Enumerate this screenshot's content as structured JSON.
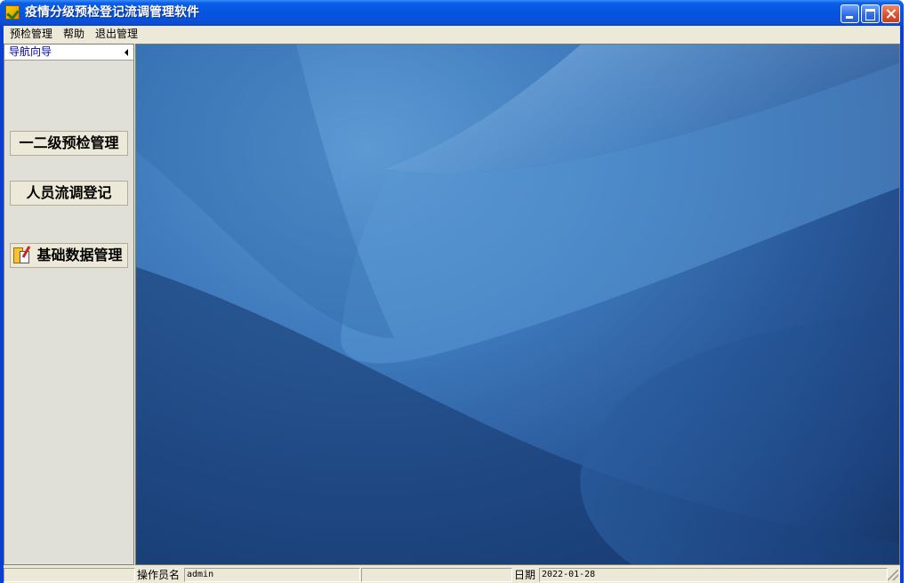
{
  "window": {
    "title": "疫情分级预检登记流调管理软件",
    "app_icon": "checkmark-app-icon",
    "controls": [
      "minimize-icon",
      "maximize-icon",
      "close-icon"
    ]
  },
  "menubar": {
    "items": [
      {
        "label": "预检管理"
      },
      {
        "label": "帮助"
      },
      {
        "label": "退出管理"
      }
    ]
  },
  "nav_panel": {
    "title": "导航向导",
    "collapse_icon": "triangle-left-icon",
    "buttons": [
      {
        "label": "一二级预检管理"
      },
      {
        "label": "人员流调登记"
      },
      {
        "label": "基础数据管理",
        "icon": "folder-doc-pencil-icon"
      }
    ]
  },
  "statusbar": {
    "operator_label": "操作员名",
    "operator_value": "admin",
    "date_label": "日期",
    "date_value": "2022-01-28"
  },
  "colors": {
    "titlebar": "#0654e0",
    "face": "#ece9d8",
    "nav_title": "#0000a0"
  }
}
